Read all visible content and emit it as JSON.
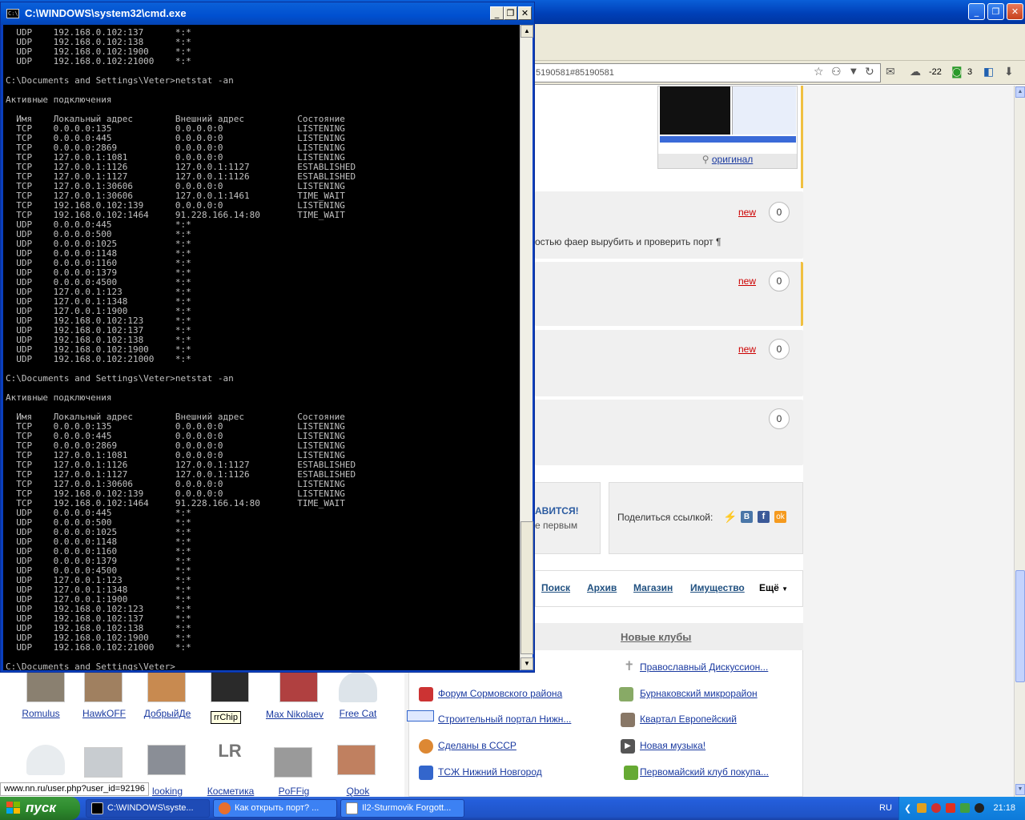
{
  "cmd": {
    "title": "C:\\WINDOWS\\system32\\cmd.exe",
    "lines": [
      "  UDP    192.168.0.102:137      *:*",
      "  UDP    192.168.0.102:138      *:*",
      "  UDP    192.168.0.102:1900     *:*",
      "  UDP    192.168.0.102:21000    *:*",
      "",
      "C:\\Documents and Settings\\Veter>netstat -an",
      "",
      "Активные подключения",
      "",
      "  Имя    Локальный адрес        Внешний адрес          Состояние",
      "  TCP    0.0.0.0:135            0.0.0.0:0              LISTENING",
      "  TCP    0.0.0.0:445            0.0.0.0:0              LISTENING",
      "  TCP    0.0.0.0:2869           0.0.0.0:0              LISTENING",
      "  TCP    127.0.0.1:1081         0.0.0.0:0              LISTENING",
      "  TCP    127.0.0.1:1126         127.0.0.1:1127         ESTABLISHED",
      "  TCP    127.0.0.1:1127         127.0.0.1:1126         ESTABLISHED",
      "  TCP    127.0.0.1:30606        0.0.0.0:0              LISTENING",
      "  TCP    127.0.0.1:30606        127.0.0.1:1461         TIME_WAIT",
      "  TCP    192.168.0.102:139      0.0.0.0:0              LISTENING",
      "  TCP    192.168.0.102:1464     91.228.166.14:80       TIME_WAIT",
      "  UDP    0.0.0.0:445            *:*",
      "  UDP    0.0.0.0:500            *:*",
      "  UDP    0.0.0.0:1025           *:*",
      "  UDP    0.0.0.0:1148           *:*",
      "  UDP    0.0.0.0:1160           *:*",
      "  UDP    0.0.0.0:1379           *:*",
      "  UDP    0.0.0.0:4500           *:*",
      "  UDP    127.0.0.1:123          *:*",
      "  UDP    127.0.0.1:1348         *:*",
      "  UDP    127.0.0.1:1900         *:*",
      "  UDP    192.168.0.102:123      *:*",
      "  UDP    192.168.0.102:137      *:*",
      "  UDP    192.168.0.102:138      *:*",
      "  UDP    192.168.0.102:1900     *:*",
      "  UDP    192.168.0.102:21000    *:*",
      "",
      "C:\\Documents and Settings\\Veter>netstat -an",
      "",
      "Активные подключения",
      "",
      "  Имя    Локальный адрес        Внешний адрес          Состояние",
      "  TCP    0.0.0.0:135            0.0.0.0:0              LISTENING",
      "  TCP    0.0.0.0:445            0.0.0.0:0              LISTENING",
      "  TCP    0.0.0.0:2869           0.0.0.0:0              LISTENING",
      "  TCP    127.0.0.1:1081         0.0.0.0:0              LISTENING",
      "  TCP    127.0.0.1:1126         127.0.0.1:1127         ESTABLISHED",
      "  TCP    127.0.0.1:1127         127.0.0.1:1126         ESTABLISHED",
      "  TCP    127.0.0.1:30606        0.0.0.0:0              LISTENING",
      "  TCP    192.168.0.102:139      0.0.0.0:0              LISTENING",
      "  TCP    192.168.0.102:1464     91.228.166.14:80       TIME_WAIT",
      "  UDP    0.0.0.0:445            *:*",
      "  UDP    0.0.0.0:500            *:*",
      "  UDP    0.0.0.0:1025           *:*",
      "  UDP    0.0.0.0:1148           *:*",
      "  UDP    0.0.0.0:1160           *:*",
      "  UDP    0.0.0.0:1379           *:*",
      "  UDP    0.0.0.0:4500           *:*",
      "  UDP    127.0.0.1:123          *:*",
      "  UDP    127.0.0.1:1348         *:*",
      "  UDP    127.0.0.1:1900         *:*",
      "  UDP    192.168.0.102:123      *:*",
      "  UDP    192.168.0.102:137      *:*",
      "  UDP    192.168.0.102:138      *:*",
      "  UDP    192.168.0.102:1900     *:*",
      "  UDP    192.168.0.102:21000    *:*",
      "",
      "C:\\Documents and Settings\\Veter>_"
    ]
  },
  "browser": {
    "url": "5190581#85190581",
    "toolbar": {
      "weather": "-22",
      "badge_count": "3"
    },
    "original_link": "оригинал",
    "comments": [
      {
        "new_label": "new",
        "count": "0",
        "text": "остью фаер вырубить и проверить порт ¶"
      },
      {
        "new_label": "new",
        "count": "0",
        "text": ""
      },
      {
        "new_label": "new",
        "count": "0",
        "text": ""
      },
      {
        "new_label": "",
        "count": "0",
        "text": ""
      }
    ],
    "like_box": {
      "title": "АВИТСЯ!",
      "subtitle": "е первым"
    },
    "share": {
      "label": "Поделиться ссылкой:"
    },
    "tabs": [
      "Поиск",
      "Архив",
      "Магазин",
      "Имущество"
    ],
    "more_tab": "Ещё",
    "new_clubs_title": "Новые клубы",
    "clubs_left": [
      "Форум Сормовского района",
      "Строительный портал Нижн...",
      "Сделаны в СССР",
      "ТСЖ Нижний Новгород"
    ],
    "clubs_right": [
      "Православный Дискуссион...",
      "Бурнаковский микрорайон",
      "Квартал Европейский",
      "Новая музыка!",
      "Первомайский клуб покупа..."
    ],
    "users_row1": [
      "Romulus",
      "HawkOFF",
      "ДобрыйДе",
      "",
      "Max Nikolaev",
      "Free Cat"
    ],
    "users_row2": [
      "",
      "",
      "looking",
      "Косметика",
      "PoFFig",
      "Qbok"
    ],
    "tooltip": "rrChip",
    "status_url": "www.nn.ru/user.php?user_id=92196"
  },
  "taskbar": {
    "start_label": "пуск",
    "tasks": [
      "C:\\WINDOWS\\syste...",
      "Как открыть порт? ...",
      "Il2-Sturmovik Forgott..."
    ],
    "lang": "RU",
    "clock": "21:18"
  }
}
